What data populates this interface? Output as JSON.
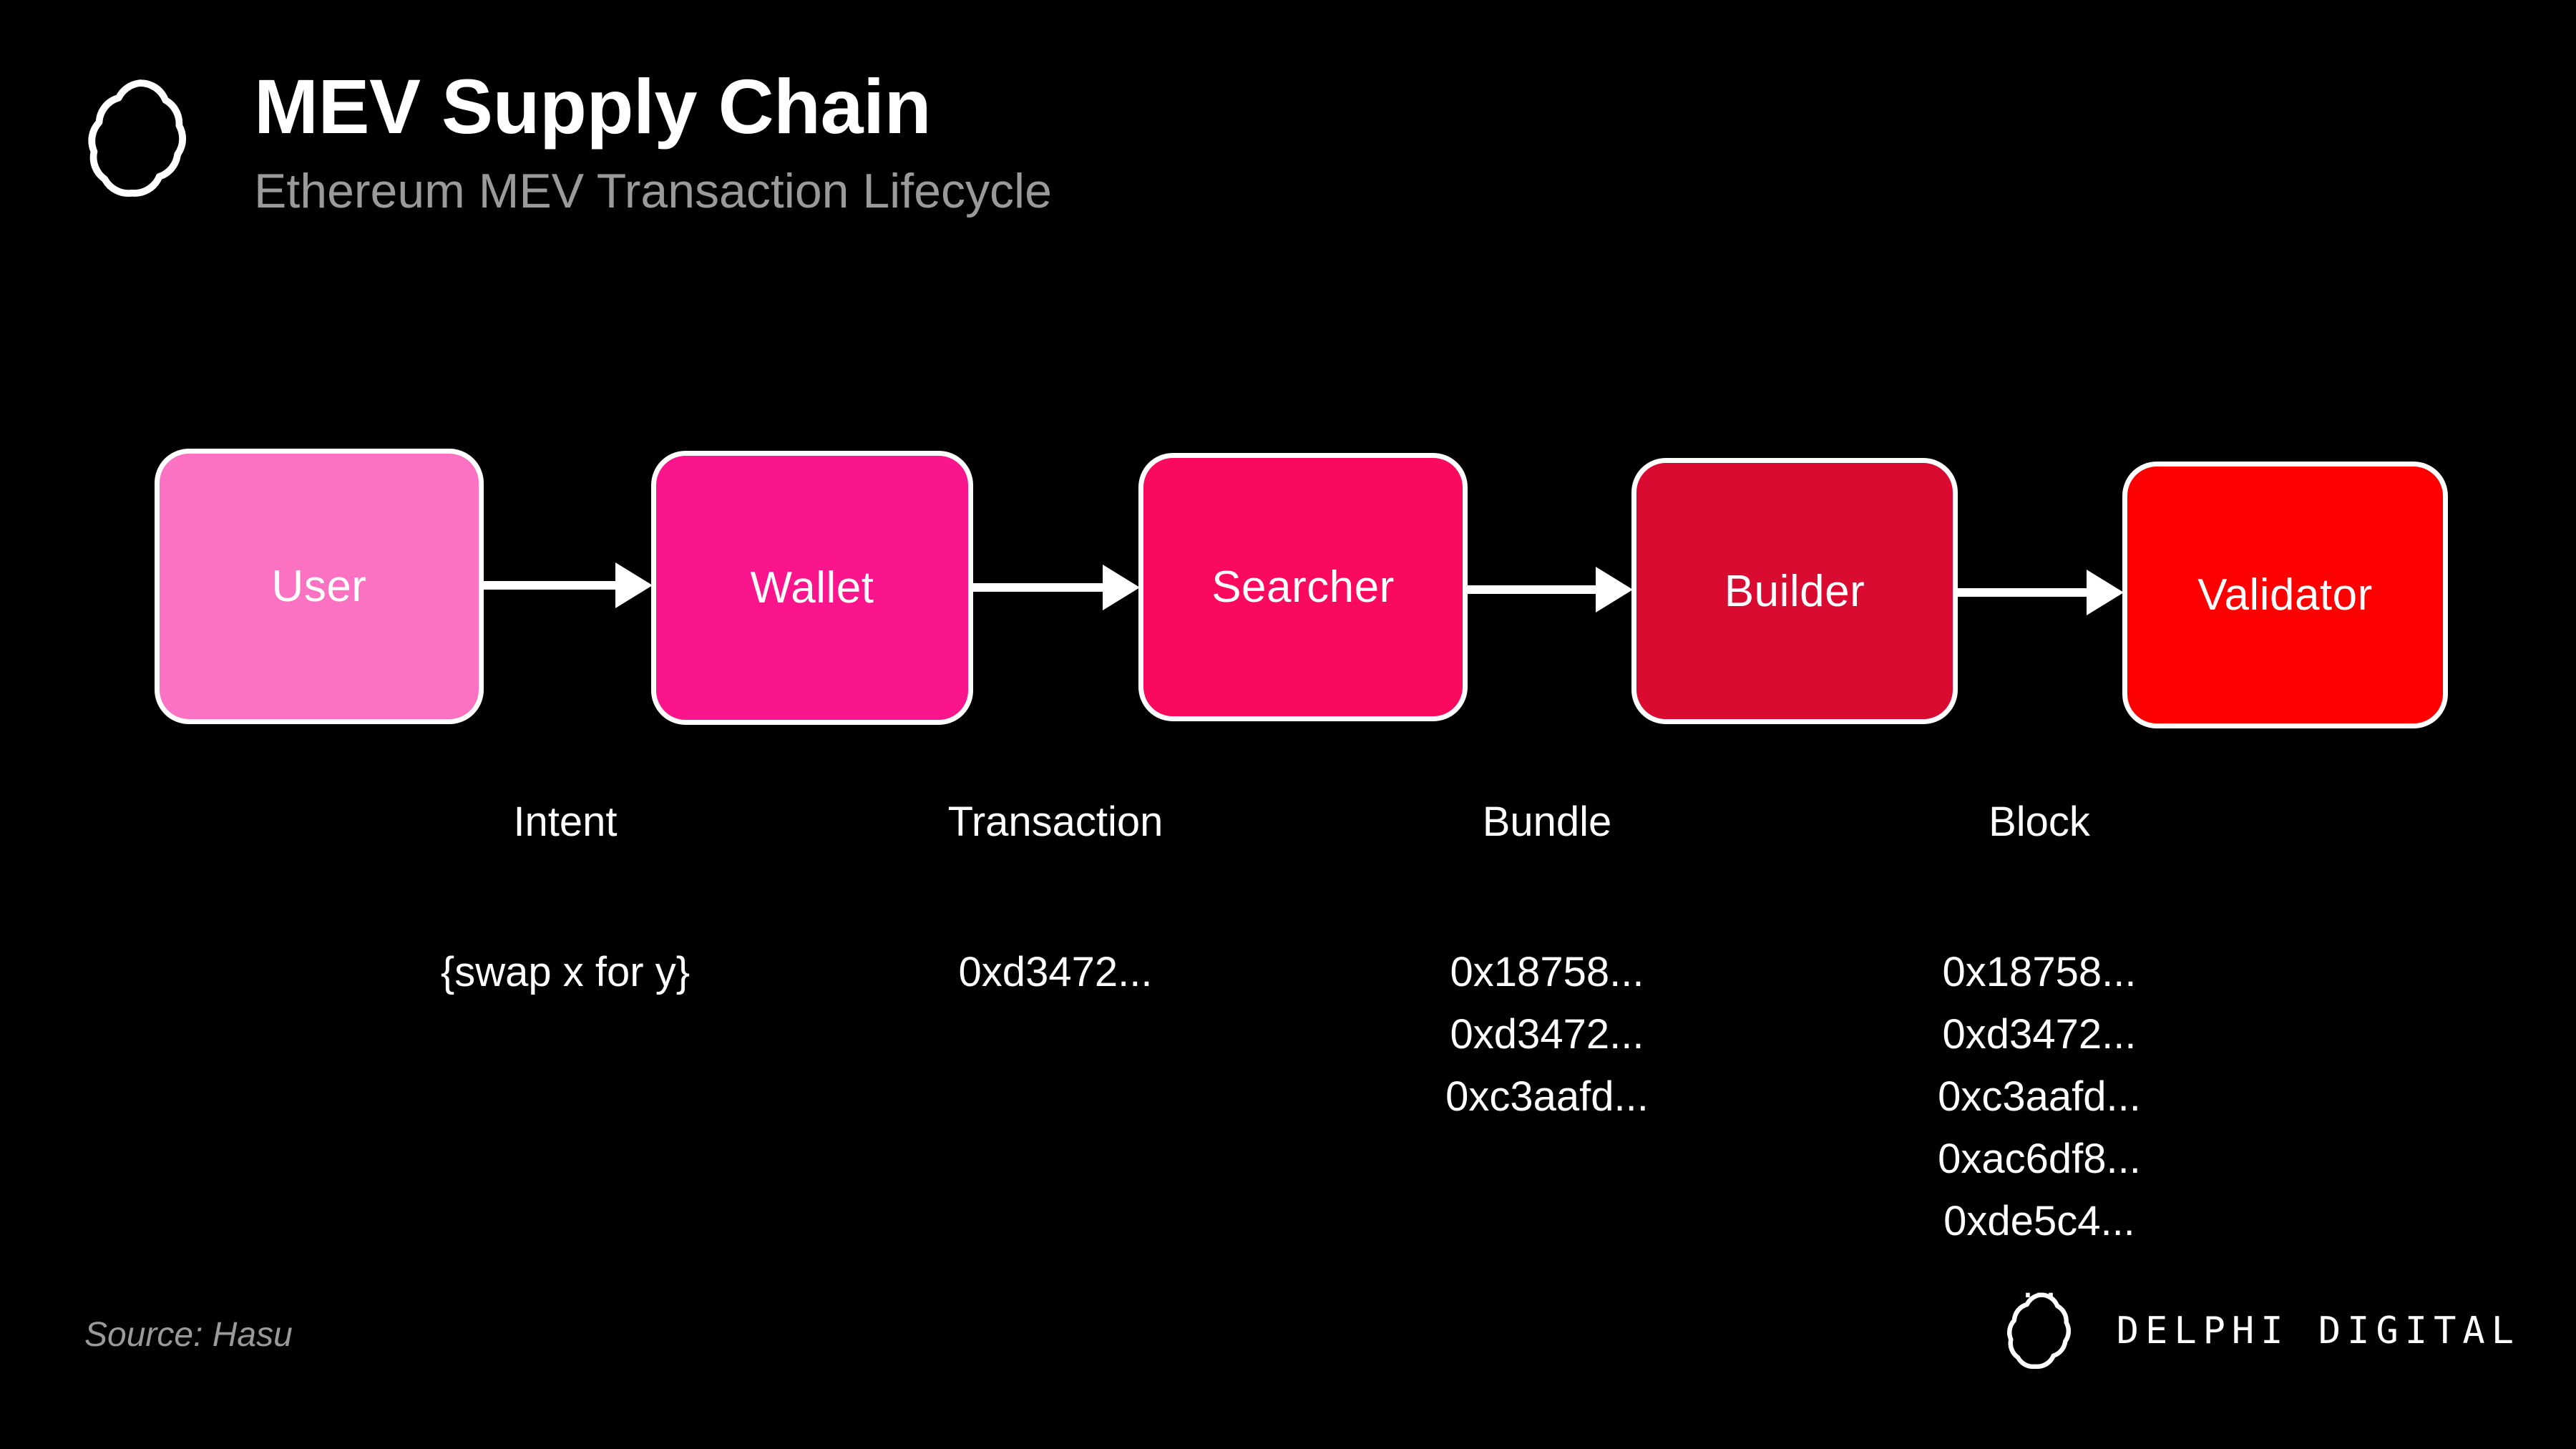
{
  "header": {
    "title": "MEV Supply Chain",
    "subtitle": "Ethereum MEV Transaction Lifecycle",
    "logo_icon": "delphi-knot-icon"
  },
  "colors": {
    "background": "#000000",
    "node_border": "#ffffff",
    "arrow": "#ffffff",
    "title": "#ffffff",
    "subtitle": "#9a9a9a",
    "source_note": "#9a9a9a",
    "node_user": "#FB72C3",
    "node_wallet": "#FA158C",
    "node_searcher": "#FA0A5F",
    "node_builder": "#DA0B30",
    "node_validator": "#FF0000"
  },
  "chart_data": {
    "type": "diagram",
    "title": "MEV Supply Chain",
    "subtitle": "Ethereum MEV Transaction Lifecycle",
    "nodes": [
      {
        "id": "user",
        "label": "User",
        "color": "#FB72C3"
      },
      {
        "id": "wallet",
        "label": "Wallet",
        "color": "#FA158C"
      },
      {
        "id": "searcher",
        "label": "Searcher",
        "color": "#FA0A5F"
      },
      {
        "id": "builder",
        "label": "Builder",
        "color": "#DA0B30"
      },
      {
        "id": "validator",
        "label": "Validator",
        "color": "#FF0000"
      }
    ],
    "edges": [
      {
        "from": "user",
        "to": "wallet",
        "label": "Intent"
      },
      {
        "from": "wallet",
        "to": "searcher",
        "label": "Transaction"
      },
      {
        "from": "searcher",
        "to": "builder",
        "label": "Bundle"
      },
      {
        "from": "builder",
        "to": "validator",
        "label": "Block"
      }
    ]
  },
  "flow": {
    "nodes": [
      {
        "label": "User"
      },
      {
        "label": "Wallet"
      },
      {
        "label": "Searcher"
      },
      {
        "label": "Builder"
      },
      {
        "label": "Validator"
      }
    ],
    "columns": [
      {
        "label": "Intent",
        "payload": [
          "{swap x for y}"
        ]
      },
      {
        "label": "Transaction",
        "payload": [
          "0xd3472..."
        ]
      },
      {
        "label": "Bundle",
        "payload": [
          "0x18758...",
          "0xd3472...",
          "0xc3aafd..."
        ]
      },
      {
        "label": "Block",
        "payload": [
          "0x18758...",
          "0xd3472...",
          "0xc3aafd...",
          "0xac6df8...",
          "0xde5c4...",
          "..."
        ]
      }
    ]
  },
  "footer": {
    "source": "Source: Hasu",
    "wordmark": "DELPHI DIGITAL",
    "logo_icon": "delphi-knot-icon"
  }
}
